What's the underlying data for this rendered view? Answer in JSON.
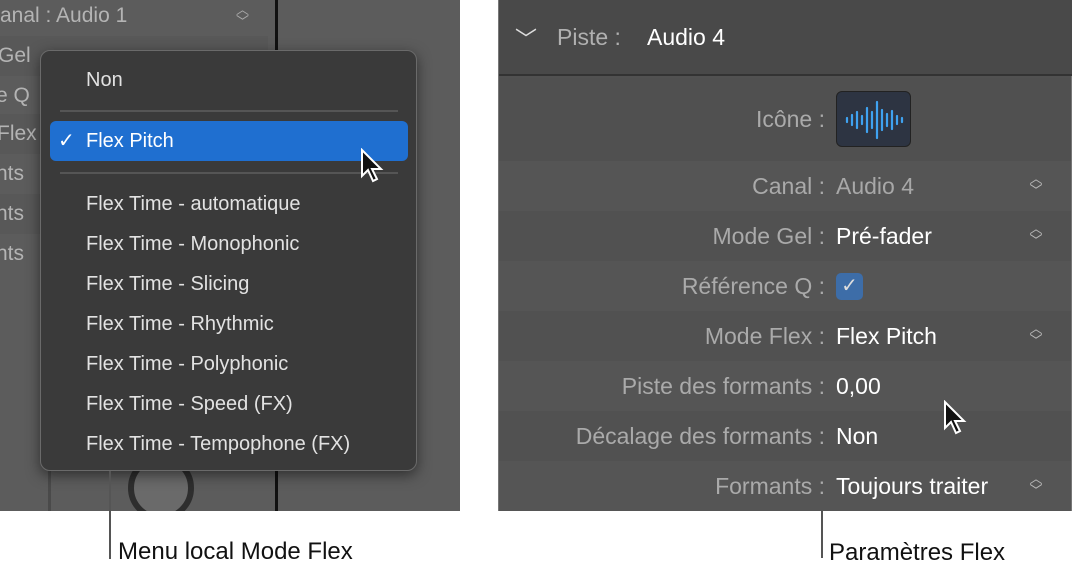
{
  "background_panel": {
    "rows": [
      "anal :  Audio 1",
      "Gel",
      "e Q",
      "Flex",
      "nts",
      "nts",
      "nts"
    ]
  },
  "flex_menu": {
    "items": [
      "Non",
      "Flex Pitch",
      "Flex Time - automatique",
      "Flex Time - Monophonic",
      "Flex Time - Slicing",
      "Flex Time - Rhythmic",
      "Flex Time - Polyphonic",
      "Flex Time - Speed (FX)",
      "Flex Time - Tempophone (FX)"
    ],
    "selected": "Flex Pitch",
    "check": "✓",
    "highlight_color": "#1f6fd0"
  },
  "inspector": {
    "header_label": "Piste :",
    "header_value": "Audio 4",
    "rows": [
      {
        "label": "Icône :",
        "type": "icon",
        "icon": "waveform-icon"
      },
      {
        "label": "Canal :",
        "value": "Audio 4",
        "stepper": true
      },
      {
        "label": "Mode Gel :",
        "value": "Pré-fader",
        "stepper": true
      },
      {
        "label": "Référence Q :",
        "type": "checkbox",
        "checked": true
      },
      {
        "label": "Mode Flex :",
        "value": "Flex Pitch",
        "stepper": true
      },
      {
        "label": "Piste des formants :",
        "value": "0,00"
      },
      {
        "label": "Décalage des formants :",
        "value": "Non"
      },
      {
        "label": "Formants :",
        "value": "Toujours traiter",
        "stepper": true
      }
    ]
  },
  "callouts": {
    "left": "Menu local Mode Flex",
    "right": "Paramètres Flex"
  }
}
